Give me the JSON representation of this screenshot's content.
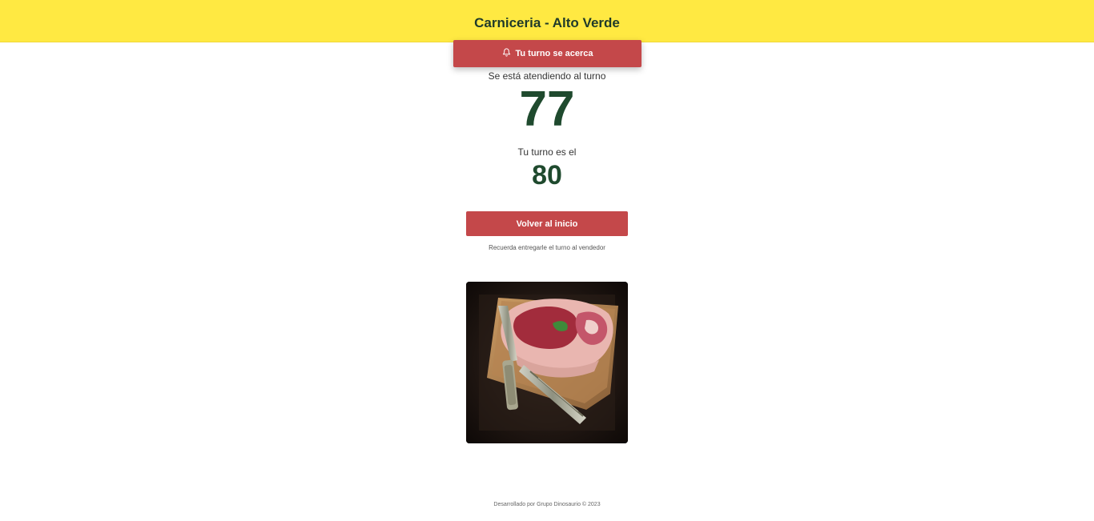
{
  "header": {
    "title": "Carniceria - Alto Verde"
  },
  "toast": {
    "icon": "bell-icon",
    "text": "Tu turno se acerca"
  },
  "serving": {
    "label": "Se está atendiendo al turno",
    "number": "77"
  },
  "turn": {
    "label": "Tu turno es el",
    "number": "80"
  },
  "actions": {
    "back_label": "Volver al inicio"
  },
  "reminder": "Recuerda entregarle el turno al vendedor",
  "footer": "Desarrollado por Grupo Dinosaurio © 2023",
  "colors": {
    "header_bg": "#ffe942",
    "accent": "#c4484a",
    "number": "#1f4a2e"
  }
}
